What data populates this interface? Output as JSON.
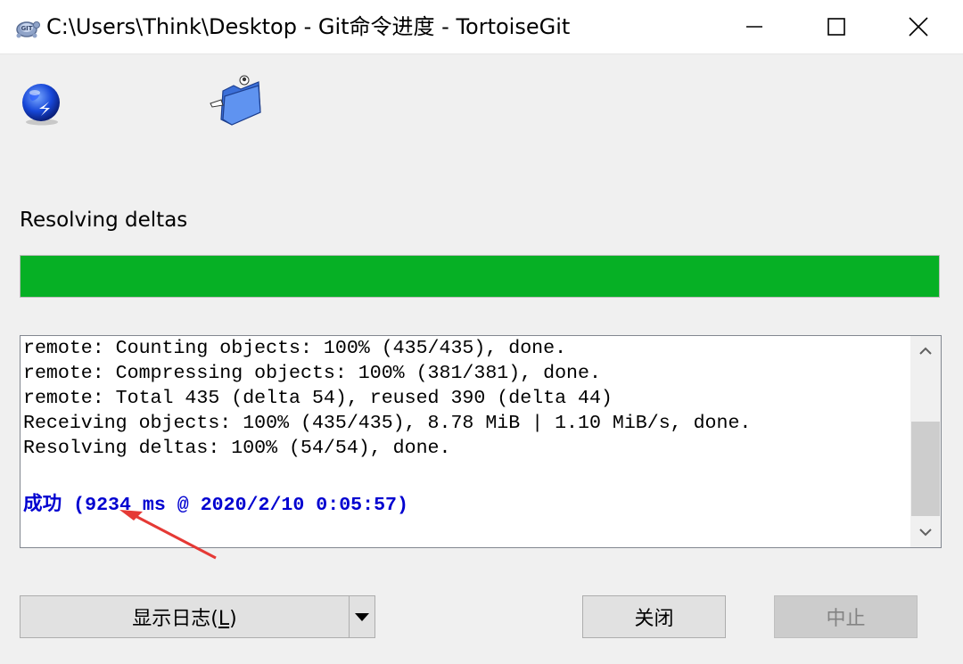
{
  "window": {
    "title": "C:\\Users\\Think\\Desktop - Git命令进度 - TortoiseGit",
    "app_icon": "tortoisegit-icon",
    "controls": [
      "minimize",
      "maximize",
      "close"
    ]
  },
  "icons": {
    "left": "globe-icon",
    "right": "folder-icon"
  },
  "status": {
    "label": "Resolving deltas",
    "progress_percent": 100,
    "progress_color": "#06b025"
  },
  "log": {
    "lines": [
      "remote: Counting objects: 100% (435/435), done.",
      "remote: Compressing objects: 100% (381/381), done.",
      "remote: Total 435 (delta 54), reused 390 (delta 44)",
      "Receiving objects: 100% (435/435), 8.78 MiB | 1.10 MiB/s, done.",
      "Resolving deltas: 100% (54/54), done."
    ],
    "success_line": "成功 (9234 ms @ 2020/2/10 0:05:57)",
    "success_color": "#0000d0"
  },
  "buttons": {
    "show_log_prefix": "显示日志(",
    "show_log_key": "L",
    "show_log_suffix": ")",
    "close": "关闭",
    "abort": "中止"
  },
  "annotation_color": "#e53935"
}
